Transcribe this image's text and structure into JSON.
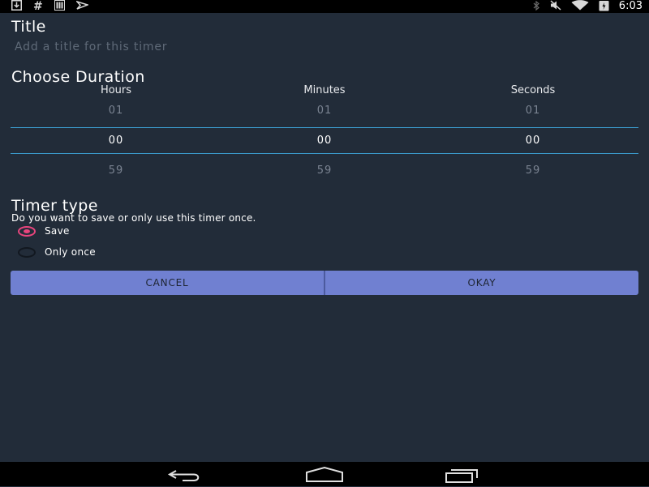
{
  "status_bar": {
    "left_icons": [
      "download-icon",
      "hash-icon",
      "signal-bars-icon",
      "flag-icon"
    ],
    "right_icons": [
      "bluetooth-icon",
      "mute-icon",
      "wifi-icon",
      "battery-icon"
    ],
    "hash_glyph": "#",
    "time": "6:03"
  },
  "title_section": {
    "heading": "Title",
    "placeholder": "Add a title for this timer",
    "value": ""
  },
  "duration": {
    "heading": "Choose Duration",
    "columns": [
      {
        "label": "Hours",
        "prev": "01",
        "current": "00",
        "next": "59"
      },
      {
        "label": "Minutes",
        "prev": "01",
        "current": "00",
        "next": "59"
      },
      {
        "label": "Seconds",
        "prev": "01",
        "current": "00",
        "next": "59"
      }
    ],
    "accent_color": "#3c9fd1"
  },
  "timer_type": {
    "heading": "Timer type",
    "description": "Do you want to save or only use this timer once.",
    "options": [
      {
        "label": "Save",
        "checked": true
      },
      {
        "label": "Only once",
        "checked": false
      }
    ],
    "radio_color": "#e8457d"
  },
  "buttons": {
    "cancel": "CANCEL",
    "okay": "OKAY",
    "color": "#7080d1"
  },
  "nav_bar": {
    "icons": [
      "back-icon",
      "home-icon",
      "recent-apps-icon"
    ]
  }
}
